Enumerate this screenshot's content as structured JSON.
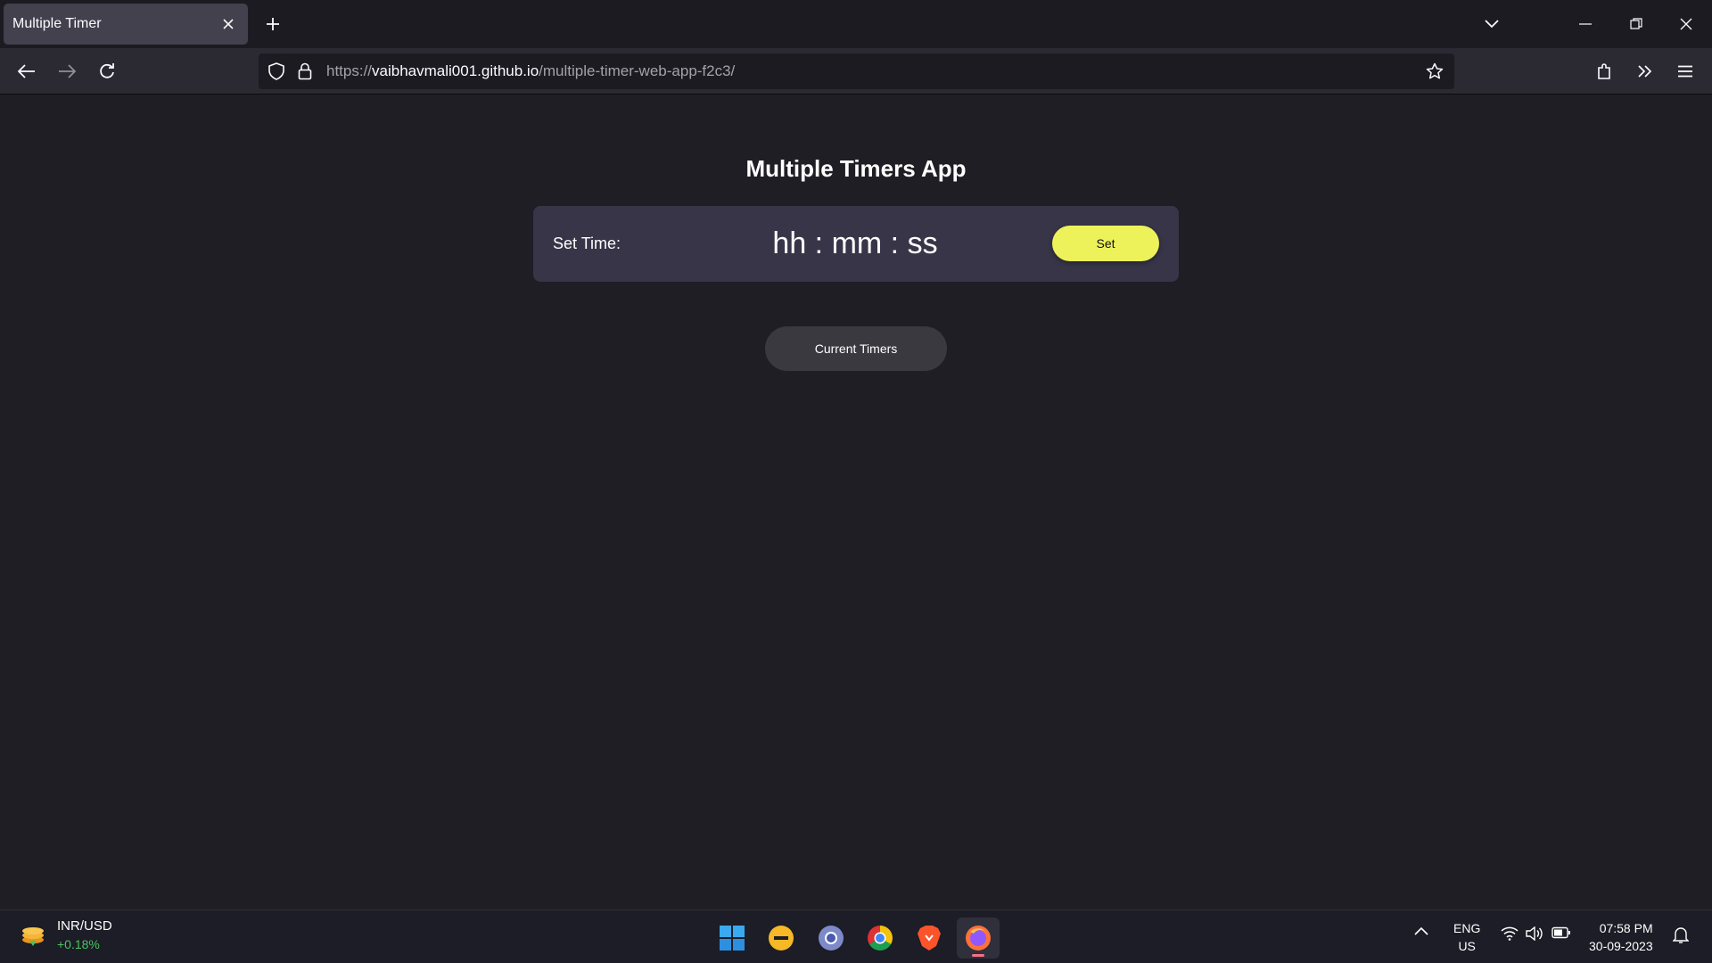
{
  "browser": {
    "tab": {
      "title": "Multiple Timer"
    },
    "url": {
      "scheme": "https://",
      "host": "vaibhavmali001.github.io",
      "path": "/multiple-timer-web-app-f2c3/"
    }
  },
  "app": {
    "title": "Multiple Timers App",
    "set_time_label": "Set Time:",
    "time_input_placeholder": "hh : mm : ss",
    "set_button_label": "Set",
    "current_timers_label": "Current Timers",
    "colors": {
      "set_button": "#eef25a",
      "card": "#373547",
      "page_bg": "#1f1e25"
    }
  },
  "taskbar": {
    "widget": {
      "title": "INR/USD",
      "change": "+0.18%"
    },
    "apps": [
      "start-menu",
      "file-explorer",
      "chromium",
      "chrome",
      "brave",
      "firefox"
    ],
    "language": {
      "line1": "ENG",
      "line2": "US"
    },
    "clock": {
      "time": "07:58 PM",
      "date": "30-09-2023"
    }
  }
}
